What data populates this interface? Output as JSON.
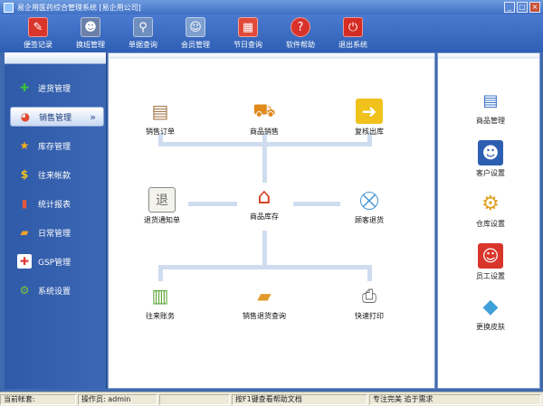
{
  "window": {
    "title": "易企用医药综合管理系统 [易企用公司]",
    "controls": [
      "_",
      "□",
      "×"
    ]
  },
  "toolbar": {
    "items": [
      {
        "label": "便签记录",
        "icon": "notepad-icon",
        "glyph": "✎",
        "color": "#d9352b"
      },
      {
        "label": "换班管理",
        "icon": "users-icon",
        "glyph": "☻",
        "color": "#6b7fa8"
      },
      {
        "label": "单据查询",
        "icon": "magnifier-icon",
        "glyph": "⚲",
        "color": "#6f8fc0"
      },
      {
        "label": "会员管理",
        "icon": "members-icon",
        "glyph": "☺",
        "color": "#7fa0cf"
      },
      {
        "label": "节日查询",
        "icon": "calendar-icon",
        "glyph": "▦",
        "color": "#e04a3a"
      },
      {
        "label": "软件帮助",
        "icon": "help-icon",
        "glyph": "?",
        "color": "#d8322a"
      },
      {
        "label": "退出系统",
        "icon": "power-icon",
        "glyph": "⏻",
        "color": "#d42c24"
      }
    ]
  },
  "sidebar": {
    "items": [
      {
        "label": "进货管理",
        "icon": "plus-icon",
        "glyph": "✚",
        "color": "#3fbf3a"
      },
      {
        "label": "销售管理",
        "icon": "pie-chart-icon",
        "glyph": "◕",
        "color": "#e2492e",
        "active": true,
        "chevron": "»"
      },
      {
        "label": "库存管理",
        "icon": "star-icon",
        "glyph": "★",
        "color": "#f5b01b"
      },
      {
        "label": "往来帐款",
        "icon": "dollar-icon",
        "glyph": "$",
        "color": "#f3c21a"
      },
      {
        "label": "统计报表",
        "icon": "bar-chart-icon",
        "glyph": "▮",
        "color": "#e6573b"
      },
      {
        "label": "日常管理",
        "icon": "folder-icon",
        "glyph": "▰",
        "color": "#f2a12b"
      },
      {
        "label": "GSP管理",
        "icon": "medical-kit-icon",
        "glyph": "✚",
        "color": "#e33b3b"
      },
      {
        "label": "系统设置",
        "icon": "gear-icon",
        "glyph": "⚙",
        "color": "#7fc23b"
      }
    ]
  },
  "center": {
    "modules": [
      {
        "label": "销售订单",
        "icon": "order-box-icon",
        "glyph": "▤",
        "color": "#a67a4e"
      },
      {
        "label": "商品销售",
        "icon": "truck-icon",
        "glyph": "⛟",
        "color": "#e08a1e"
      },
      {
        "label": "复核出库",
        "icon": "folder-arrow-icon",
        "glyph": "➜",
        "color": "#f0c21b"
      },
      {
        "label": "退货通知单",
        "icon": "return-notice-icon",
        "glyph": "退",
        "color": "#6b6b6b"
      },
      {
        "label": "商品库存",
        "icon": "warehouse-house-icon",
        "glyph": "⌂",
        "color": "#d9442b"
      },
      {
        "label": "顾客退货",
        "icon": "cart-remove-icon",
        "glyph": "⛒",
        "color": "#3b8fd1"
      },
      {
        "label": "往来账务",
        "icon": "ledger-icon",
        "glyph": "▥",
        "color": "#5aa634"
      },
      {
        "label": "销售退货查询",
        "icon": "folders-query-icon",
        "glyph": "▰",
        "color": "#e09a2b"
      },
      {
        "label": "快速打印",
        "icon": "printer-icon",
        "glyph": "⎙",
        "color": "#666666"
      }
    ]
  },
  "right": {
    "modules": [
      {
        "label": "商品管理",
        "icon": "product-catalog-icon",
        "glyph": "▤",
        "color": "#3b73c8"
      },
      {
        "label": "客户设置",
        "icon": "customers-icon",
        "glyph": "☻",
        "color": "#2d5fb0"
      },
      {
        "label": "仓库设置",
        "icon": "warehouse-gear-icon",
        "glyph": "⚙",
        "color": "#e0a020"
      },
      {
        "label": "员工设置",
        "icon": "staff-icon",
        "glyph": "☺",
        "color": "#d9352b"
      },
      {
        "label": "更换皮肤",
        "icon": "cube-icon",
        "glyph": "◆",
        "color": "#3fa0d8"
      }
    ]
  },
  "statusbar": {
    "account": "当前帐套:",
    "operator": "操作员: admin",
    "empty": "",
    "help": "按F1键查看帮助文档",
    "slogan": "专注完美 追于需求"
  }
}
